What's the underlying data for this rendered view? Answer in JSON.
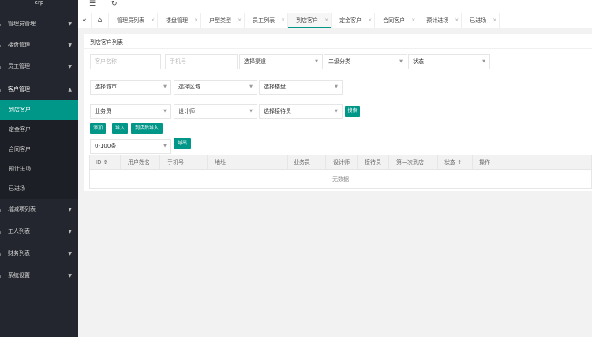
{
  "app": {
    "brand": "erp"
  },
  "header": {
    "menu_icon": "menu-fold-icon",
    "refresh_icon": "refresh-icon"
  },
  "sidebar": {
    "items": [
      {
        "label": "管理员管理"
      },
      {
        "label": "楼盘管理"
      },
      {
        "label": "员工管理"
      },
      {
        "label": "客户管理"
      },
      {
        "label": "增减项列表"
      },
      {
        "label": "工人列表"
      },
      {
        "label": "财务列表"
      },
      {
        "label": "系统设置"
      }
    ],
    "sub_items": [
      {
        "label": "到店客户"
      },
      {
        "label": "定金客户"
      },
      {
        "label": "合同客户"
      },
      {
        "label": "预计进场"
      },
      {
        "label": "已进场"
      }
    ]
  },
  "tabs": {
    "items": [
      {
        "label": "管理员列表"
      },
      {
        "label": "楼盘管理"
      },
      {
        "label": "户型类型"
      },
      {
        "label": "员工列表"
      },
      {
        "label": "到店客户"
      },
      {
        "label": "定金客户"
      },
      {
        "label": "合同客户"
      },
      {
        "label": "预计进场"
      },
      {
        "label": "已进场"
      }
    ],
    "close": "×"
  },
  "card": {
    "title": "到店客户列表"
  },
  "filters": {
    "name_placeholder": "客户名称",
    "phone_placeholder": "手机号",
    "channel": "选择渠道",
    "subcategory": "二级分类",
    "status": "状态",
    "city": "选择城市",
    "area": "选择区域",
    "estate": "选择楼盘",
    "salesman": "业务员",
    "designer": "设计师",
    "receptionist": "选择接待员",
    "search_label": "搜索"
  },
  "actions": {
    "add": "添加",
    "import": "导入",
    "import_after": "到店后导入",
    "range": "0-100条",
    "export": "导出"
  },
  "table": {
    "columns": [
      "ID",
      "用户姓名",
      "手机号",
      "地址",
      "业务员",
      "设计师",
      "接待员",
      "第一次到店",
      "状态",
      "操作"
    ],
    "sort_glyph": "⇕",
    "empty": "无数据"
  },
  "colors": {
    "accent": "#009688",
    "sidebar": "#23262e"
  }
}
